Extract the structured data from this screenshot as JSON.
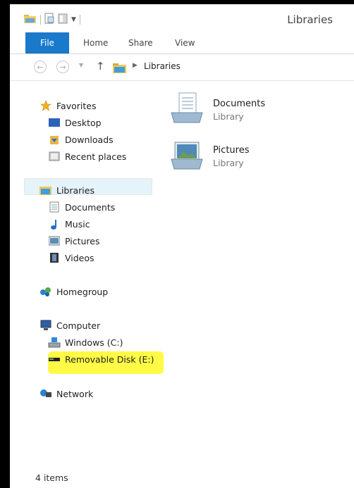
{
  "window": {
    "title": "Libraries"
  },
  "ribbon": {
    "tabs": [
      "File",
      "Home",
      "Share",
      "View"
    ]
  },
  "address": {
    "path": "Libraries"
  },
  "nav": {
    "favorites": {
      "label": "Favorites",
      "items": [
        "Desktop",
        "Downloads",
        "Recent places"
      ]
    },
    "libraries": {
      "label": "Libraries",
      "items": [
        "Documents",
        "Music",
        "Pictures",
        "Videos"
      ]
    },
    "homegroup": {
      "label": "Homegroup"
    },
    "computer": {
      "label": "Computer",
      "items": [
        "Windows (C:)",
        "Removable Disk (E:)"
      ]
    },
    "network": {
      "label": "Network"
    }
  },
  "content": {
    "items": [
      {
        "name": "Documents",
        "type": "Library"
      },
      {
        "name": "Pictures",
        "type": "Library"
      }
    ]
  },
  "status": {
    "count": "4 items"
  },
  "colors": {
    "file_tab": "#1979ca",
    "selection": "#e5f3fb",
    "highlight": "#fffa3c"
  }
}
